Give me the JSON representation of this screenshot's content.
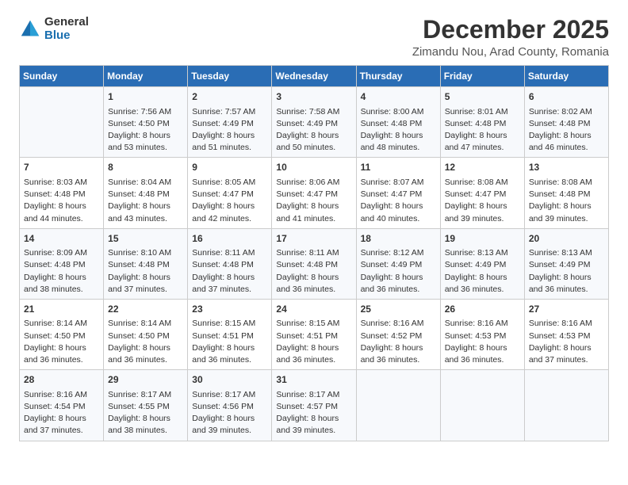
{
  "logo": {
    "general": "General",
    "blue": "Blue"
  },
  "title": {
    "month": "December 2025",
    "location": "Zimandu Nou, Arad County, Romania"
  },
  "weekdays": [
    "Sunday",
    "Monday",
    "Tuesday",
    "Wednesday",
    "Thursday",
    "Friday",
    "Saturday"
  ],
  "weeks": [
    [
      {
        "day": "",
        "sunrise": "",
        "sunset": "",
        "daylight": ""
      },
      {
        "day": "1",
        "sunrise": "Sunrise: 7:56 AM",
        "sunset": "Sunset: 4:50 PM",
        "daylight": "Daylight: 8 hours and 53 minutes."
      },
      {
        "day": "2",
        "sunrise": "Sunrise: 7:57 AM",
        "sunset": "Sunset: 4:49 PM",
        "daylight": "Daylight: 8 hours and 51 minutes."
      },
      {
        "day": "3",
        "sunrise": "Sunrise: 7:58 AM",
        "sunset": "Sunset: 4:49 PM",
        "daylight": "Daylight: 8 hours and 50 minutes."
      },
      {
        "day": "4",
        "sunrise": "Sunrise: 8:00 AM",
        "sunset": "Sunset: 4:48 PM",
        "daylight": "Daylight: 8 hours and 48 minutes."
      },
      {
        "day": "5",
        "sunrise": "Sunrise: 8:01 AM",
        "sunset": "Sunset: 4:48 PM",
        "daylight": "Daylight: 8 hours and 47 minutes."
      },
      {
        "day": "6",
        "sunrise": "Sunrise: 8:02 AM",
        "sunset": "Sunset: 4:48 PM",
        "daylight": "Daylight: 8 hours and 46 minutes."
      }
    ],
    [
      {
        "day": "7",
        "sunrise": "Sunrise: 8:03 AM",
        "sunset": "Sunset: 4:48 PM",
        "daylight": "Daylight: 8 hours and 44 minutes."
      },
      {
        "day": "8",
        "sunrise": "Sunrise: 8:04 AM",
        "sunset": "Sunset: 4:48 PM",
        "daylight": "Daylight: 8 hours and 43 minutes."
      },
      {
        "day": "9",
        "sunrise": "Sunrise: 8:05 AM",
        "sunset": "Sunset: 4:47 PM",
        "daylight": "Daylight: 8 hours and 42 minutes."
      },
      {
        "day": "10",
        "sunrise": "Sunrise: 8:06 AM",
        "sunset": "Sunset: 4:47 PM",
        "daylight": "Daylight: 8 hours and 41 minutes."
      },
      {
        "day": "11",
        "sunrise": "Sunrise: 8:07 AM",
        "sunset": "Sunset: 4:47 PM",
        "daylight": "Daylight: 8 hours and 40 minutes."
      },
      {
        "day": "12",
        "sunrise": "Sunrise: 8:08 AM",
        "sunset": "Sunset: 4:47 PM",
        "daylight": "Daylight: 8 hours and 39 minutes."
      },
      {
        "day": "13",
        "sunrise": "Sunrise: 8:08 AM",
        "sunset": "Sunset: 4:48 PM",
        "daylight": "Daylight: 8 hours and 39 minutes."
      }
    ],
    [
      {
        "day": "14",
        "sunrise": "Sunrise: 8:09 AM",
        "sunset": "Sunset: 4:48 PM",
        "daylight": "Daylight: 8 hours and 38 minutes."
      },
      {
        "day": "15",
        "sunrise": "Sunrise: 8:10 AM",
        "sunset": "Sunset: 4:48 PM",
        "daylight": "Daylight: 8 hours and 37 minutes."
      },
      {
        "day": "16",
        "sunrise": "Sunrise: 8:11 AM",
        "sunset": "Sunset: 4:48 PM",
        "daylight": "Daylight: 8 hours and 37 minutes."
      },
      {
        "day": "17",
        "sunrise": "Sunrise: 8:11 AM",
        "sunset": "Sunset: 4:48 PM",
        "daylight": "Daylight: 8 hours and 36 minutes."
      },
      {
        "day": "18",
        "sunrise": "Sunrise: 8:12 AM",
        "sunset": "Sunset: 4:49 PM",
        "daylight": "Daylight: 8 hours and 36 minutes."
      },
      {
        "day": "19",
        "sunrise": "Sunrise: 8:13 AM",
        "sunset": "Sunset: 4:49 PM",
        "daylight": "Daylight: 8 hours and 36 minutes."
      },
      {
        "day": "20",
        "sunrise": "Sunrise: 8:13 AM",
        "sunset": "Sunset: 4:49 PM",
        "daylight": "Daylight: 8 hours and 36 minutes."
      }
    ],
    [
      {
        "day": "21",
        "sunrise": "Sunrise: 8:14 AM",
        "sunset": "Sunset: 4:50 PM",
        "daylight": "Daylight: 8 hours and 36 minutes."
      },
      {
        "day": "22",
        "sunrise": "Sunrise: 8:14 AM",
        "sunset": "Sunset: 4:50 PM",
        "daylight": "Daylight: 8 hours and 36 minutes."
      },
      {
        "day": "23",
        "sunrise": "Sunrise: 8:15 AM",
        "sunset": "Sunset: 4:51 PM",
        "daylight": "Daylight: 8 hours and 36 minutes."
      },
      {
        "day": "24",
        "sunrise": "Sunrise: 8:15 AM",
        "sunset": "Sunset: 4:51 PM",
        "daylight": "Daylight: 8 hours and 36 minutes."
      },
      {
        "day": "25",
        "sunrise": "Sunrise: 8:16 AM",
        "sunset": "Sunset: 4:52 PM",
        "daylight": "Daylight: 8 hours and 36 minutes."
      },
      {
        "day": "26",
        "sunrise": "Sunrise: 8:16 AM",
        "sunset": "Sunset: 4:53 PM",
        "daylight": "Daylight: 8 hours and 36 minutes."
      },
      {
        "day": "27",
        "sunrise": "Sunrise: 8:16 AM",
        "sunset": "Sunset: 4:53 PM",
        "daylight": "Daylight: 8 hours and 37 minutes."
      }
    ],
    [
      {
        "day": "28",
        "sunrise": "Sunrise: 8:16 AM",
        "sunset": "Sunset: 4:54 PM",
        "daylight": "Daylight: 8 hours and 37 minutes."
      },
      {
        "day": "29",
        "sunrise": "Sunrise: 8:17 AM",
        "sunset": "Sunset: 4:55 PM",
        "daylight": "Daylight: 8 hours and 38 minutes."
      },
      {
        "day": "30",
        "sunrise": "Sunrise: 8:17 AM",
        "sunset": "Sunset: 4:56 PM",
        "daylight": "Daylight: 8 hours and 39 minutes."
      },
      {
        "day": "31",
        "sunrise": "Sunrise: 8:17 AM",
        "sunset": "Sunset: 4:57 PM",
        "daylight": "Daylight: 8 hours and 39 minutes."
      },
      {
        "day": "",
        "sunrise": "",
        "sunset": "",
        "daylight": ""
      },
      {
        "day": "",
        "sunrise": "",
        "sunset": "",
        "daylight": ""
      },
      {
        "day": "",
        "sunrise": "",
        "sunset": "",
        "daylight": ""
      }
    ]
  ]
}
